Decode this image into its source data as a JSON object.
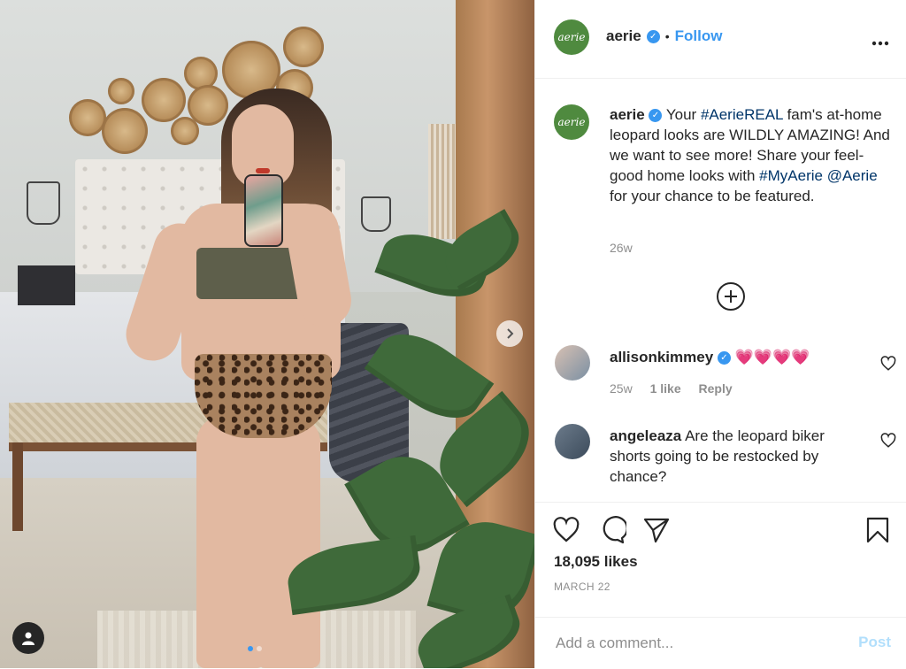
{
  "header": {
    "username": "aerie",
    "avatar_text": "aerie",
    "separator": "•",
    "follow_label": "Follow",
    "more_icon": "more-horizontal-icon"
  },
  "caption": {
    "username": "aerie",
    "text_before": "Your ",
    "hashtag1": "#AerieREAL",
    "text_middle": " fam's at-home leopard looks are WILDLY AMAZING! And we want to see more! Share your feel-good home looks with ",
    "hashtag2": "#MyAerie",
    "space": " ",
    "mention": "@Aerie",
    "text_after": " for your chance to be featured.",
    "age": "26w"
  },
  "comments": [
    {
      "username": "allisonkimmey",
      "verified": true,
      "text": "💗💗💗💗",
      "time": "25w",
      "likes": "1 like",
      "reply": "Reply"
    },
    {
      "username": "angeleaza",
      "verified": false,
      "text": "Are the leopard biker shorts going to be restocked by chance?"
    }
  ],
  "actions": {
    "likes": "18,095 likes",
    "date": "MARCH 22"
  },
  "add_comment": {
    "placeholder": "Add a comment...",
    "post_label": "Post"
  },
  "colors": {
    "accent": "#3897f0",
    "brand_green": "#4f8a3f",
    "hashtag": "#003569",
    "muted": "#8e8e8e"
  }
}
